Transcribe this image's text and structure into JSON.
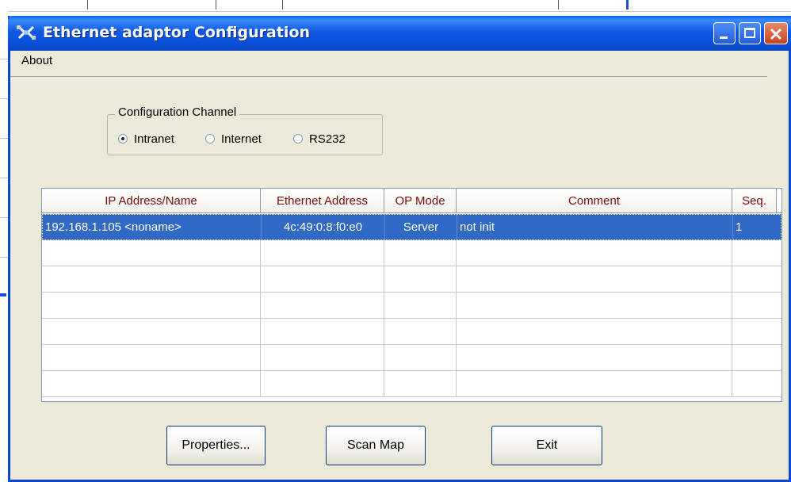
{
  "window": {
    "title": "Ethernet adaptor Configuration",
    "colors": {
      "titlebar": "#0a4fd6",
      "face": "#ece9d8",
      "selection": "#316ac5",
      "header_text": "#7a0b0b"
    }
  },
  "menubar": {
    "items": [
      {
        "label": "About"
      }
    ]
  },
  "config_channel": {
    "title": "Configuration Channel",
    "options": [
      {
        "label": "Intranet",
        "selected": true
      },
      {
        "label": "Internet",
        "selected": false
      },
      {
        "label": "RS232",
        "selected": false
      }
    ]
  },
  "devices": {
    "columns": [
      {
        "label": "IP Address/Name"
      },
      {
        "label": "Ethernet Address"
      },
      {
        "label": "OP Mode"
      },
      {
        "label": "Comment"
      },
      {
        "label": "Seq."
      }
    ],
    "rows": [
      {
        "ip_name": "192.168.1.105 <noname>",
        "ethernet": "4c:49:0:8:f0:e0",
        "op_mode": "Server",
        "comment": "not init",
        "seq": "1",
        "selected": true
      }
    ],
    "empty_rows": 6
  },
  "buttons": {
    "properties": "Properties...",
    "scan_map": "Scan Map",
    "exit": "Exit"
  },
  "icons": {
    "app": "network-cable-icon",
    "minimize": "minimize-icon",
    "maximize": "maximize-icon",
    "close": "close-icon"
  }
}
